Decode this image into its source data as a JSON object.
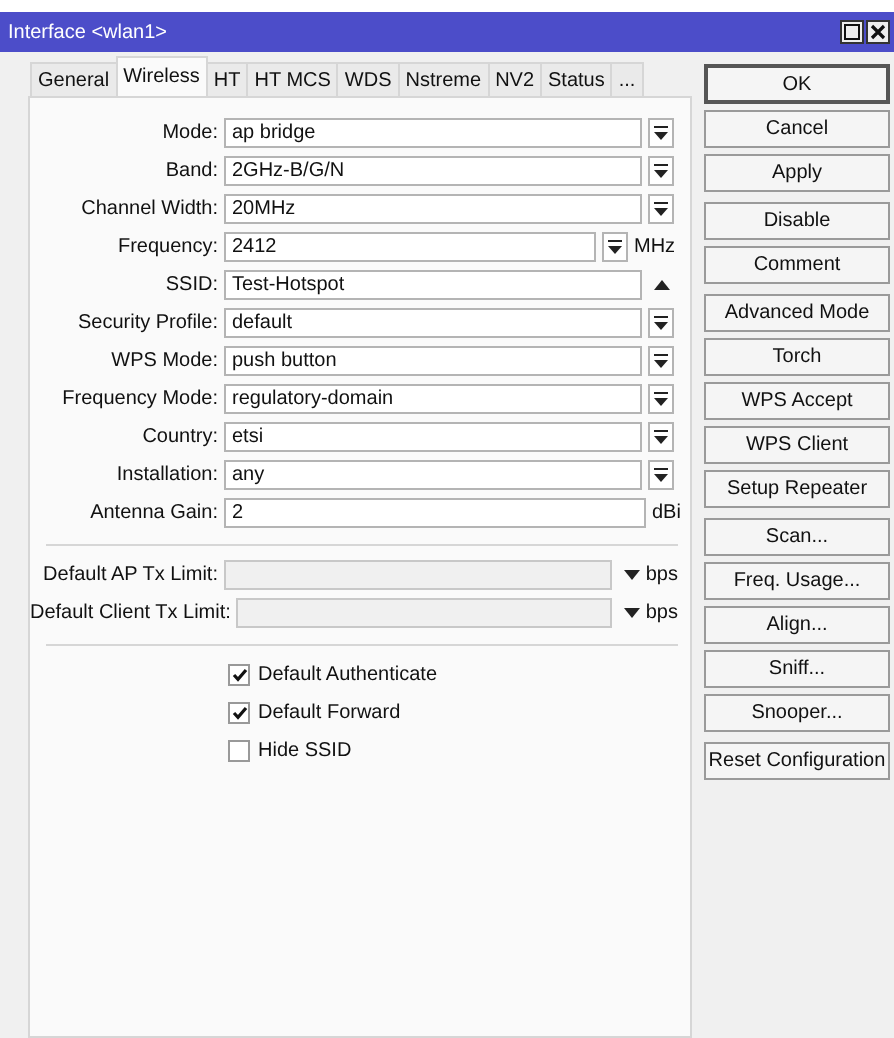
{
  "window": {
    "title": "Interface <wlan1>"
  },
  "tabs": [
    {
      "label": "General",
      "selected": false
    },
    {
      "label": "Wireless",
      "selected": true
    },
    {
      "label": "HT",
      "selected": false
    },
    {
      "label": "HT MCS",
      "selected": false
    },
    {
      "label": "WDS",
      "selected": false
    },
    {
      "label": "Nstreme",
      "selected": false
    },
    {
      "label": "NV2",
      "selected": false
    },
    {
      "label": "Status",
      "selected": false
    },
    {
      "label": "...",
      "selected": false
    }
  ],
  "fields": [
    {
      "kind": "select",
      "label": "Mode:",
      "value": "ap bridge"
    },
    {
      "kind": "select",
      "label": "Band:",
      "value": "2GHz-B/G/N"
    },
    {
      "kind": "select",
      "label": "Channel Width:",
      "value": "20MHz"
    },
    {
      "kind": "select_unit",
      "label": "Frequency:",
      "value": "2412",
      "unit": "MHz"
    },
    {
      "kind": "expand",
      "label": "SSID:",
      "value": "Test-Hotspot"
    },
    {
      "kind": "select",
      "label": "Security Profile:",
      "value": "default"
    },
    {
      "kind": "select",
      "label": "WPS Mode:",
      "value": "push button"
    },
    {
      "kind": "select",
      "label": "Frequency Mode:",
      "value": "regulatory-domain"
    },
    {
      "kind": "select",
      "label": "Country:",
      "value": "etsi"
    },
    {
      "kind": "select",
      "label": "Installation:",
      "value": "any"
    },
    {
      "kind": "text_unit",
      "label": "Antenna Gain:",
      "value": "2",
      "unit": "dBi"
    }
  ],
  "limits": [
    {
      "label": "Default AP Tx Limit:",
      "unit": "bps",
      "disabled": true
    },
    {
      "label": "Default Client Tx Limit:",
      "unit": "bps",
      "disabled": true
    }
  ],
  "checkboxes": [
    {
      "label": "Default Authenticate",
      "checked": true
    },
    {
      "label": "Default Forward",
      "checked": true
    },
    {
      "label": "Hide SSID",
      "checked": false
    }
  ],
  "button_groups": [
    [
      "OK",
      "Cancel",
      "Apply"
    ],
    [
      "Disable",
      "Comment"
    ],
    [
      "Advanced Mode",
      "Torch",
      "WPS Accept",
      "WPS Client",
      "Setup Repeater"
    ],
    [
      "Scan...",
      "Freq. Usage...",
      "Align...",
      "Sniff...",
      "Snooper..."
    ],
    [
      "Reset Configuration"
    ]
  ]
}
